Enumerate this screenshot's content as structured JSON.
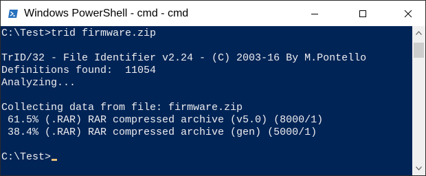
{
  "window": {
    "title": "Windows PowerShell - cmd - cmd",
    "controls": {
      "minimize": "minimize",
      "maximize": "maximize",
      "close": "close"
    }
  },
  "console": {
    "lines": [
      "C:\\Test>trid firmware.zip",
      "",
      "TrID/32 - File Identifier v2.24 - (C) 2003-16 By M.Pontello",
      "Definitions found:  11054",
      "Analyzing...",
      "",
      "Collecting data from file: firmware.zip",
      " 61.5% (.RAR) RAR compressed archive (v5.0) (8000/1)",
      " 38.4% (.RAR) RAR compressed archive (gen) (5000/1)",
      "",
      "C:\\Test>"
    ]
  },
  "colors": {
    "console_background": "#012456",
    "console_text": "#eeedf0",
    "cursor": "#e6c07b"
  },
  "icons": {
    "app": "powershell-icon",
    "minimize": "minimize-icon",
    "maximize": "maximize-icon",
    "close": "close-icon",
    "scroll_up": "arrow-up-icon",
    "scroll_down": "arrow-down-icon"
  }
}
